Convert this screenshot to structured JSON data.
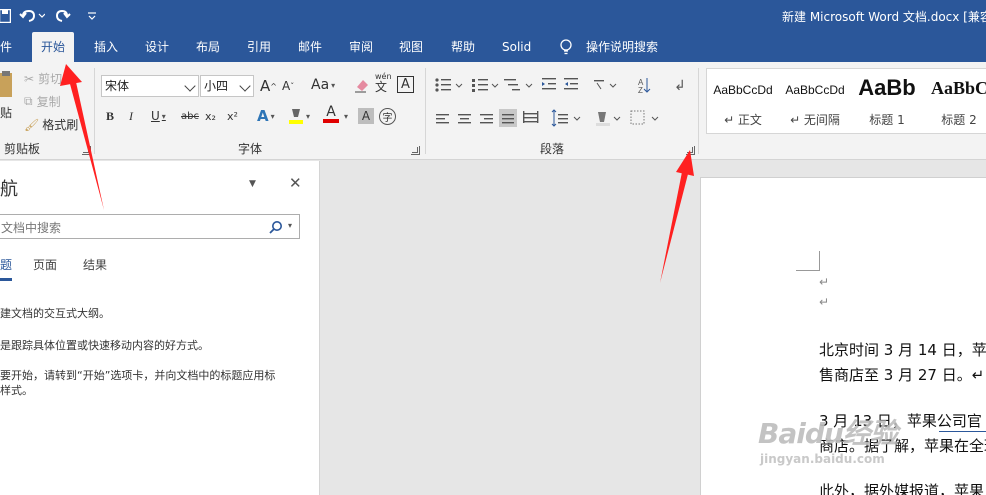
{
  "titlebar": {
    "title": "新建 Microsoft Word 文档.docx [兼容"
  },
  "qat": {
    "save_icon": "save-icon",
    "undo_icon": "undo-icon",
    "redo_icon": "redo-icon",
    "customize_icon": "customize-qat-icon"
  },
  "tabs": [
    {
      "label": "件"
    },
    {
      "label": "开始"
    },
    {
      "label": "插入"
    },
    {
      "label": "设计"
    },
    {
      "label": "布局"
    },
    {
      "label": "引用"
    },
    {
      "label": "邮件"
    },
    {
      "label": "审阅"
    },
    {
      "label": "视图"
    },
    {
      "label": "帮助"
    },
    {
      "label": "Solid"
    }
  ],
  "tell_me": "操作说明搜索",
  "clipboard": {
    "paste": "贴",
    "cut": "剪切",
    "copy": "复制",
    "format_painter": "格式刷",
    "label": "剪贴板"
  },
  "font": {
    "name": "宋体",
    "size": "小四",
    "label": "字体",
    "grow": "A",
    "shrink": "A",
    "case": "Aa",
    "bold": "B",
    "italic": "I",
    "underline": "U",
    "strike": "abc",
    "subscript": "x₂",
    "superscript": "x²",
    "phonetic": "wén",
    "border_char": "A",
    "effects": "A",
    "color": "A",
    "shading": "A",
    "enclose": "字"
  },
  "paragraph": {
    "label": "段落"
  },
  "styles": [
    {
      "sample": "AaBbCcDd",
      "name": "↵ 正文"
    },
    {
      "sample": "AaBbCcDd",
      "name": "↵ 无间隔"
    },
    {
      "sample": "AaBb",
      "name": "标题 1"
    },
    {
      "sample": "AaBbC",
      "name": "标题 2"
    }
  ],
  "navpane": {
    "title": "导航",
    "search_placeholder": "文档中搜索",
    "tabs": [
      "题",
      "页面",
      "结果"
    ],
    "lines": [
      "建文档的交互式大纲。",
      "是跟踪具体位置或快速移动内容的好方式。",
      "要开始，请转到“开始”选项卡，并向文档中的标题应用标",
      "样式。"
    ]
  },
  "document": {
    "paragraph_mark": "↵",
    "lines": [
      "北京时间 3 月 14 日，苹",
      "售商店至 3 月 27 日。↵",
      "3 月 13 日，苹果公司官",
      "商店。据了解，苹果在全球",
      "此外，据外媒报道，苹果"
    ]
  },
  "watermark": {
    "brand": "Baidu经验",
    "url": "jingyan.baidu.com"
  }
}
